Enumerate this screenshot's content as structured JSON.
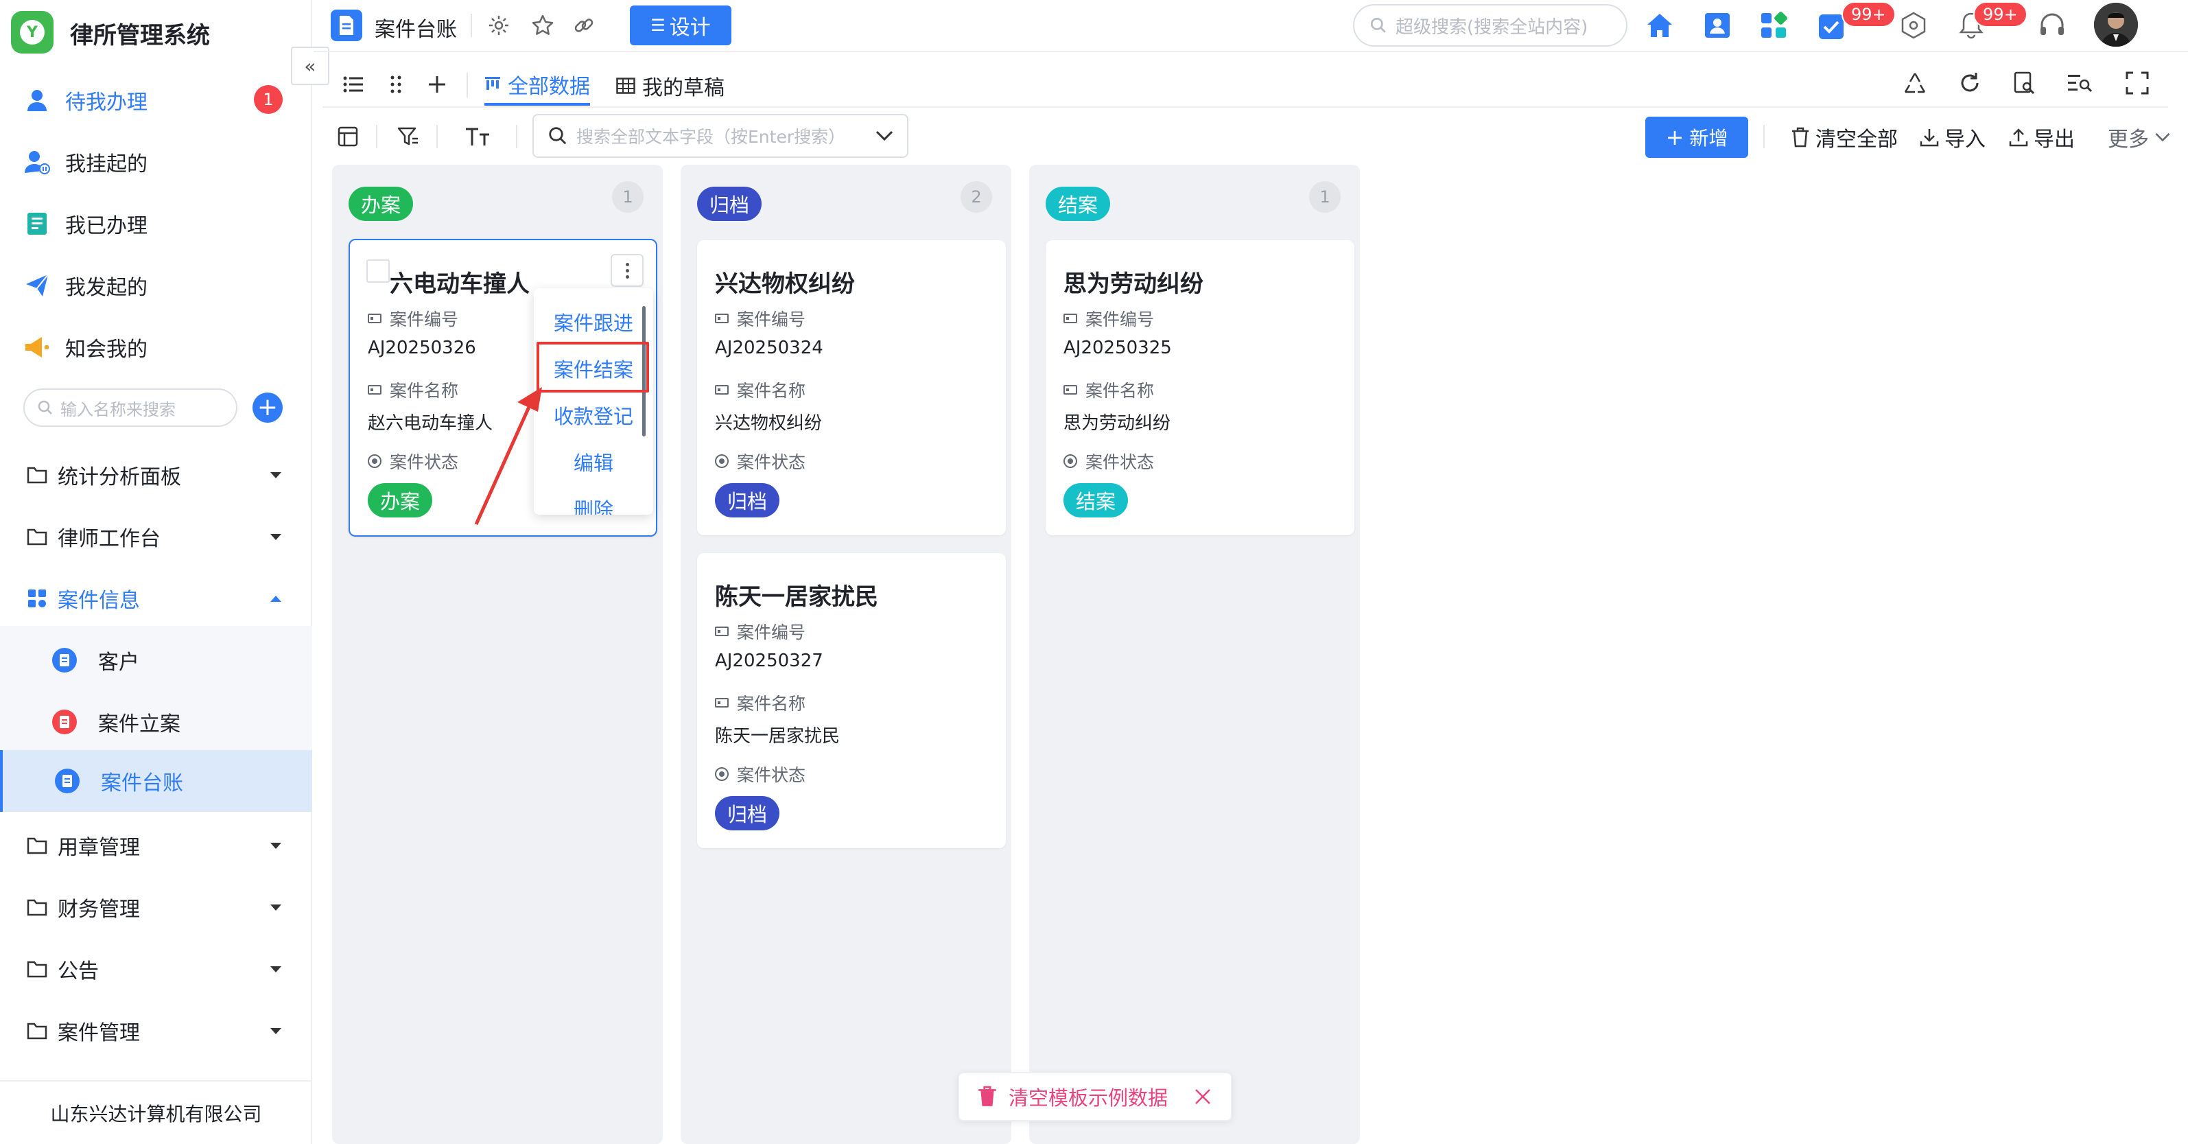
{
  "app": {
    "title": "律所管理系统",
    "logo_letter": "Y"
  },
  "sidebar": {
    "collapse_icon": "«",
    "quick_items": [
      {
        "label": "待我办理",
        "badge": "1",
        "icon": "user-icon"
      },
      {
        "label": "我挂起的",
        "icon": "user-pause-icon"
      },
      {
        "label": "我已办理",
        "icon": "doc-check-icon"
      },
      {
        "label": "我发起的",
        "icon": "send-icon"
      },
      {
        "label": "知会我的",
        "icon": "megaphone-icon"
      }
    ],
    "search_placeholder": "输入名称来搜索",
    "groups": [
      {
        "label": "统计分析面板"
      },
      {
        "label": "律师工作台"
      },
      {
        "label": "案件信息",
        "expanded": true,
        "children": [
          {
            "label": "客户",
            "color": "#2f7cf6"
          },
          {
            "label": "案件立案",
            "color": "#f5454a"
          },
          {
            "label": "案件台账",
            "color": "#2f7cf6",
            "active": true
          }
        ]
      },
      {
        "label": "用章管理"
      },
      {
        "label": "财务管理"
      },
      {
        "label": "公告"
      },
      {
        "label": "案件管理"
      }
    ],
    "footer": "山东兴达计算机有限公司"
  },
  "topbar": {
    "page_title": "案件台账",
    "design_label": "设计",
    "search_placeholder": "超级搜索(搜索全站内容)",
    "badge_todo": "99+",
    "badge_notify": "99+"
  },
  "tabs": [
    {
      "label": "全部数据",
      "active": true
    },
    {
      "label": "我的草稿",
      "active": false
    }
  ],
  "toolbar": {
    "search_placeholder": "搜索全部文本字段（按Enter搜索）",
    "add_label": "新增",
    "clear_label": "清空全部",
    "import_label": "导入",
    "export_label": "导出",
    "more_label": "更多"
  },
  "board": {
    "columns": [
      {
        "status": "办案",
        "count": "1",
        "color": "#21b85a",
        "cards": [
          {
            "title": "六电动车撞人",
            "code_label": "案件编号",
            "code": "AJ20250326",
            "name_label": "案件名称",
            "name": "赵六电动车撞人",
            "status_label": "案件状态",
            "status": "办案"
          }
        ]
      },
      {
        "status": "归档",
        "count": "2",
        "color": "#3a4fc7",
        "cards": [
          {
            "title": "兴达物权纠纷",
            "code_label": "案件编号",
            "code": "AJ20250324",
            "name_label": "案件名称",
            "name": "兴达物权纠纷",
            "status_label": "案件状态",
            "status": "归档"
          },
          {
            "title": "陈天一居家扰民",
            "code_label": "案件编号",
            "code": "AJ20250327",
            "name_label": "案件名称",
            "name": "陈天一居家扰民",
            "status_label": "案件状态",
            "status": "归档"
          }
        ]
      },
      {
        "status": "结案",
        "count": "1",
        "color": "#16c0c9",
        "cards": [
          {
            "title": "思为劳动纠纷",
            "code_label": "案件编号",
            "code": "AJ20250325",
            "name_label": "案件名称",
            "name": "思为劳动纠纷",
            "status_label": "案件状态",
            "status": "结案"
          }
        ]
      }
    ]
  },
  "context_menu": {
    "items": [
      "案件跟进",
      "案件结案",
      "收款登记",
      "编辑",
      "删除"
    ],
    "highlighted": "案件结案"
  },
  "toast": {
    "label": "清空模板示例数据"
  }
}
